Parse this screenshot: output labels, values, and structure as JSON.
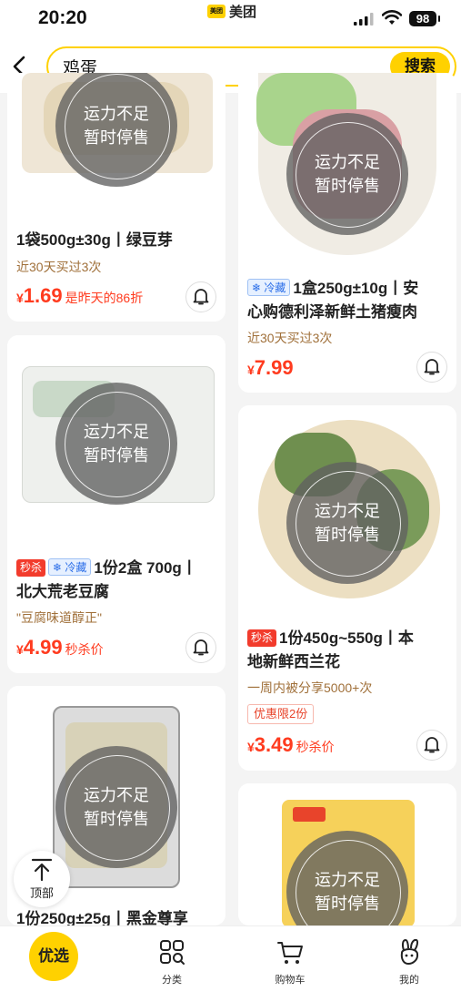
{
  "status": {
    "time": "20:20",
    "app_name": "美团",
    "app_logo_text": "美团",
    "battery": "98"
  },
  "search": {
    "query": "鸡蛋",
    "button": "搜索"
  },
  "soldout": {
    "line1": "运力不足",
    "line2": "暂时停售"
  },
  "products": {
    "bean_sprout": {
      "title": "1袋500g±30g丨绿豆芽",
      "sub": "近30天买过3次",
      "yen": "¥",
      "price": "1.69",
      "note": "是昨天的86折"
    },
    "pork": {
      "tag_cold": "冷藏",
      "title_line1": "1盒250g±10g丨安",
      "title_line2": "心购德利泽新鲜土猪瘦肉",
      "sub": "近30天买过3次",
      "yen": "¥",
      "price": "7.99"
    },
    "tofu": {
      "tag_sale": "秒杀",
      "tag_cold": "冷藏",
      "title_line1": "1份2盒 700g丨",
      "title_line2": "北大荒老豆腐",
      "sub": "\"豆腐味道醇正\"",
      "yen": "¥",
      "price": "4.99",
      "note": "秒杀价"
    },
    "broccoli": {
      "tag_sale": "秒杀",
      "title_line1": "1份450g~550g丨本",
      "title_line2": "地新鲜西兰花",
      "sub": "一周内被分享5000+次",
      "chip": "优惠限2份",
      "yen": "¥",
      "price": "3.49",
      "note": "秒杀价"
    },
    "sprout2": {
      "title": "1份250g±25g丨黑金尊享"
    }
  },
  "totop": {
    "label": "顶部"
  },
  "tabs": {
    "youxuan": "优选",
    "category": "分类",
    "cart": "购物车",
    "mine": "我的"
  },
  "colors": {
    "brand_yellow": "#ffd100",
    "price_red": "#ff3b1f",
    "sale_red": "#f23b2c",
    "cold_blue": "#2b6ee8"
  }
}
